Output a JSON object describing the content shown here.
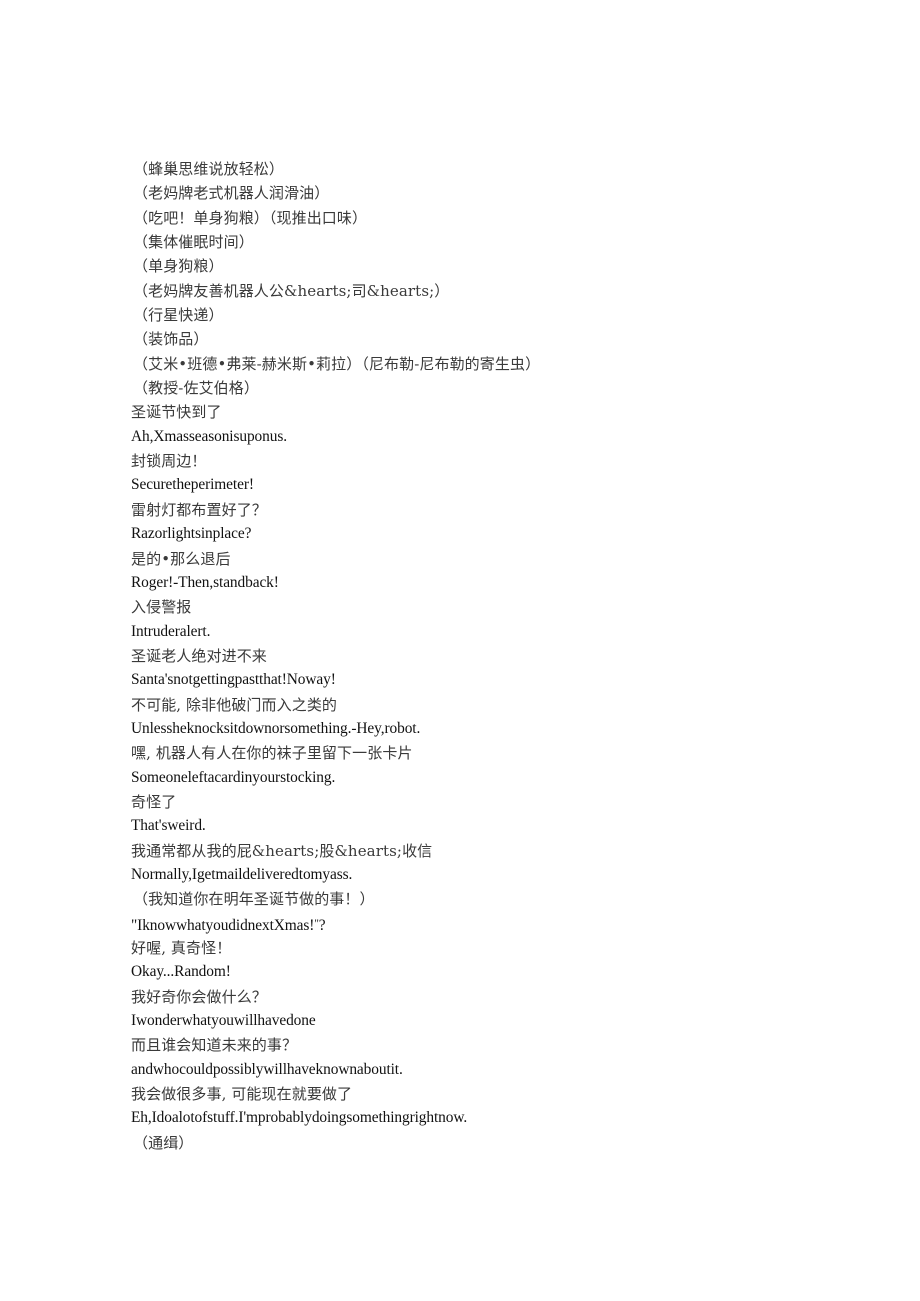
{
  "document": {
    "type": "bilingual-subtitle-transcript",
    "background_color": "#ffffff",
    "chinese_text_color": "#3a3a3a",
    "english_text_color": "#111111",
    "lines": [
      {
        "id": 1,
        "lang": "zh",
        "style": "paren",
        "text": "（蜂巢思维说放轻松）"
      },
      {
        "id": 2,
        "lang": "zh",
        "style": "paren",
        "text": "（老妈牌老式机器人润滑油）"
      },
      {
        "id": 3,
        "lang": "zh",
        "style": "paren",
        "text": "（吃吧！单身狗粮）（现推出口味）"
      },
      {
        "id": 4,
        "lang": "zh",
        "style": "paren",
        "text": "（集体催眠时间）"
      },
      {
        "id": 5,
        "lang": "zh",
        "style": "paren",
        "text": "（单身狗粮）"
      },
      {
        "id": 6,
        "lang": "zh",
        "style": "paren",
        "text": "（老妈牌友善机器人公&hearts;司&hearts;）"
      },
      {
        "id": 7,
        "lang": "zh",
        "style": "paren",
        "text": "（行星快递）"
      },
      {
        "id": 8,
        "lang": "zh",
        "style": "paren",
        "text": "（装饰品）"
      },
      {
        "id": 9,
        "lang": "zh",
        "style": "paren",
        "text": "（艾米•班德•弗莱-赫米斯•莉拉）（尼布勒-尼布勒的寄生虫）"
      },
      {
        "id": 10,
        "lang": "zh",
        "style": "paren",
        "text": "（教授-佐艾伯格）"
      },
      {
        "id": 11,
        "lang": "zh",
        "style": "plain",
        "text": "圣诞节快到了"
      },
      {
        "id": 12,
        "lang": "en",
        "style": "plain",
        "text": "Ah,Xmasseasonisuponus."
      },
      {
        "id": 13,
        "lang": "zh",
        "style": "plain",
        "text": "封锁周边！"
      },
      {
        "id": 14,
        "lang": "en",
        "style": "plain",
        "text": "Securetheperimeter!"
      },
      {
        "id": 15,
        "lang": "zh",
        "style": "plain",
        "text": "雷射灯都布置好了？"
      },
      {
        "id": 16,
        "lang": "en",
        "style": "plain",
        "text": "Razorlightsinplace?"
      },
      {
        "id": 17,
        "lang": "zh",
        "style": "plain",
        "text": "是的•那么退后"
      },
      {
        "id": 18,
        "lang": "en",
        "style": "plain",
        "text": "Roger!-Then,standback!"
      },
      {
        "id": 19,
        "lang": "zh",
        "style": "plain",
        "text": "入侵警报"
      },
      {
        "id": 20,
        "lang": "en",
        "style": "plain",
        "text": "Intruderalert."
      },
      {
        "id": 21,
        "lang": "zh",
        "style": "plain",
        "text": "圣诞老人绝对进不来"
      },
      {
        "id": 22,
        "lang": "en",
        "style": "plain",
        "text": "Santa'snotgettingpastthat!Noway!"
      },
      {
        "id": 23,
        "lang": "zh",
        "style": "plain",
        "text": "不可能, 除非他破门而入之类的"
      },
      {
        "id": 24,
        "lang": "en",
        "style": "plain",
        "text": "Unlessheknocksitdownorsomething.-Hey,robot."
      },
      {
        "id": 25,
        "lang": "zh",
        "style": "plain",
        "text": "嘿, 机器人有人在你的袜子里留下一张卡片"
      },
      {
        "id": 26,
        "lang": "en",
        "style": "plain",
        "text": "Someoneleftacardinyourstocking."
      },
      {
        "id": 27,
        "lang": "zh",
        "style": "plain",
        "text": "奇怪了"
      },
      {
        "id": 28,
        "lang": "en",
        "style": "plain",
        "text": "That'sweird."
      },
      {
        "id": 29,
        "lang": "zh",
        "style": "plain",
        "text": "我通常都从我的屁&hearts;股&hearts;收信"
      },
      {
        "id": 30,
        "lang": "en",
        "style": "plain",
        "text": "Normally,Igetmaildeliveredtomyass."
      },
      {
        "id": 31,
        "lang": "zh",
        "style": "paren",
        "text": "（我知道你在明年圣诞节做的事！）"
      },
      {
        "id": 32,
        "lang": "en",
        "style": "quote",
        "text": "\"IknowwhatyoudidnextXmas!",
        "suffix_sup": "\"",
        "suffix": "?"
      },
      {
        "id": 33,
        "lang": "zh",
        "style": "plain",
        "text": "好喔, 真奇怪！"
      },
      {
        "id": 34,
        "lang": "en",
        "style": "plain",
        "text": "Okay...Random!"
      },
      {
        "id": 35,
        "lang": "zh",
        "style": "plain",
        "text": "我好奇你会做什么？"
      },
      {
        "id": 36,
        "lang": "en",
        "style": "plain",
        "text": "Iwonderwhatyouwillhavedone"
      },
      {
        "id": 37,
        "lang": "zh",
        "style": "plain",
        "text": "而且谁会知道未来的事？"
      },
      {
        "id": 38,
        "lang": "en",
        "style": "plain",
        "text": "andwhocouldpossiblywillhaveknownaboutit."
      },
      {
        "id": 39,
        "lang": "zh",
        "style": "plain",
        "text": "我会做很多事, 可能现在就要做了"
      },
      {
        "id": 40,
        "lang": "en",
        "style": "plain",
        "text": "Eh,Idoalotofstuff.I'mprobablydoingsomethingrightnow."
      },
      {
        "id": 41,
        "lang": "zh",
        "style": "paren",
        "text": "（通缉）"
      }
    ]
  }
}
